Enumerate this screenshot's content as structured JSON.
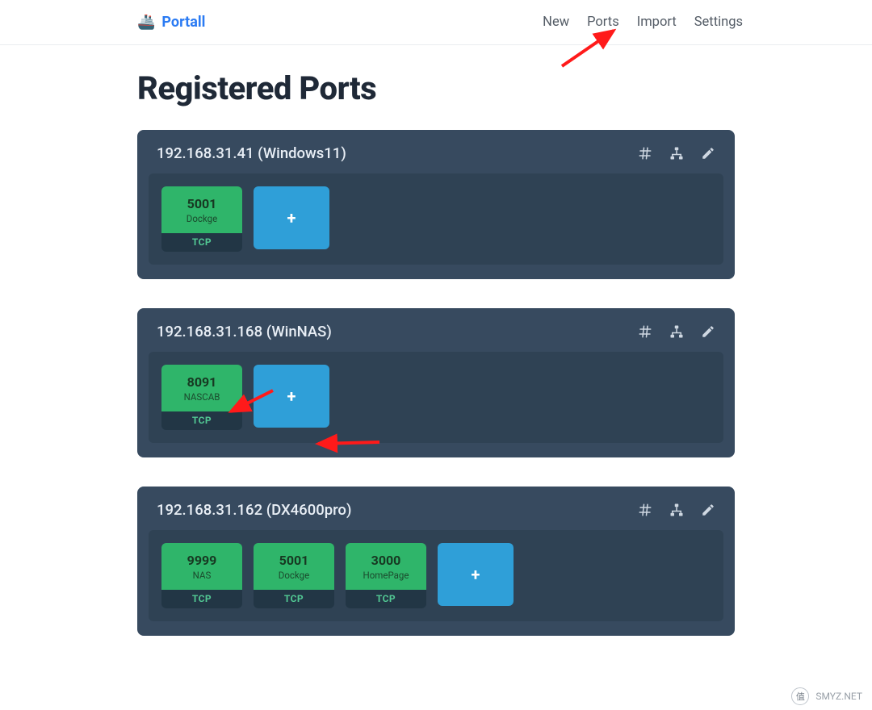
{
  "brand": {
    "icon": "🚢",
    "name": "Portall"
  },
  "nav": {
    "new": "New",
    "ports": "Ports",
    "import": "Import",
    "settings": "Settings"
  },
  "page_title": "Registered Ports",
  "hosts": [
    {
      "ip": "192.168.31.41",
      "label": "Windows11",
      "ports": [
        {
          "port": "5001",
          "name": "Dockge",
          "proto": "TCP"
        }
      ]
    },
    {
      "ip": "192.168.31.168",
      "label": "WinNAS",
      "ports": [
        {
          "port": "8091",
          "name": "NASCAB",
          "proto": "TCP"
        }
      ]
    },
    {
      "ip": "192.168.31.162",
      "label": "DX4600pro",
      "ports": [
        {
          "port": "9999",
          "name": "NAS",
          "proto": "TCP"
        },
        {
          "port": "5001",
          "name": "Dockge",
          "proto": "TCP"
        },
        {
          "port": "3000",
          "name": "HomePage",
          "proto": "TCP"
        }
      ]
    }
  ],
  "add_label": "+",
  "watermark": {
    "badge": "值",
    "text": "SMYZ.NET"
  }
}
